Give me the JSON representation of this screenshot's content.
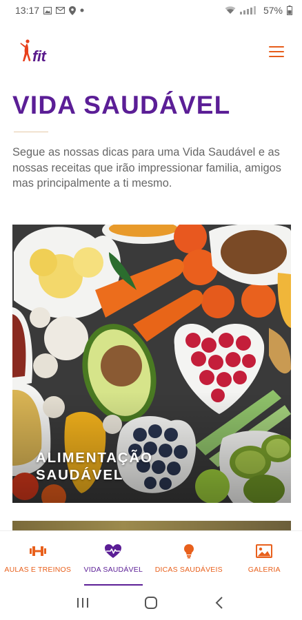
{
  "status": {
    "time": "13:17",
    "battery": "57%",
    "left_icons": [
      "image-icon",
      "gmail-icon",
      "location-icon",
      "dot-icon"
    ],
    "right_icons": [
      "wifi-icon",
      "signal-icon",
      "battery-icon"
    ]
  },
  "header": {
    "logo_text": "fit",
    "menu_icon": "hamburger-menu-icon"
  },
  "page": {
    "title": "VIDA SAUDÁVEL",
    "intro": "Segue as nossas dicas para uma Vida Saudável e as nossas receitas que irão impressionar familia, amigos mas principalmente a ti mesmo."
  },
  "cards": [
    {
      "caption_line1": "ALIMENTAÇÃO",
      "caption_line2": "SAUDÁVEL"
    }
  ],
  "bottom_nav": {
    "items": [
      {
        "label": "AULAS E TREINOS",
        "icon": "dumbbell-icon"
      },
      {
        "label": "VIDA SAUDÁVEL",
        "icon": "heartbeat-icon",
        "active": true
      },
      {
        "label": "DICAS SAUDÁVEIS",
        "icon": "lightbulb-icon"
      },
      {
        "label": "GALERIA",
        "icon": "image-gallery-icon"
      }
    ]
  },
  "system_nav": [
    "recents-icon",
    "home-icon",
    "back-icon"
  ],
  "colors": {
    "brand_purple": "#5b1e96",
    "accent_orange": "#e8601c"
  }
}
